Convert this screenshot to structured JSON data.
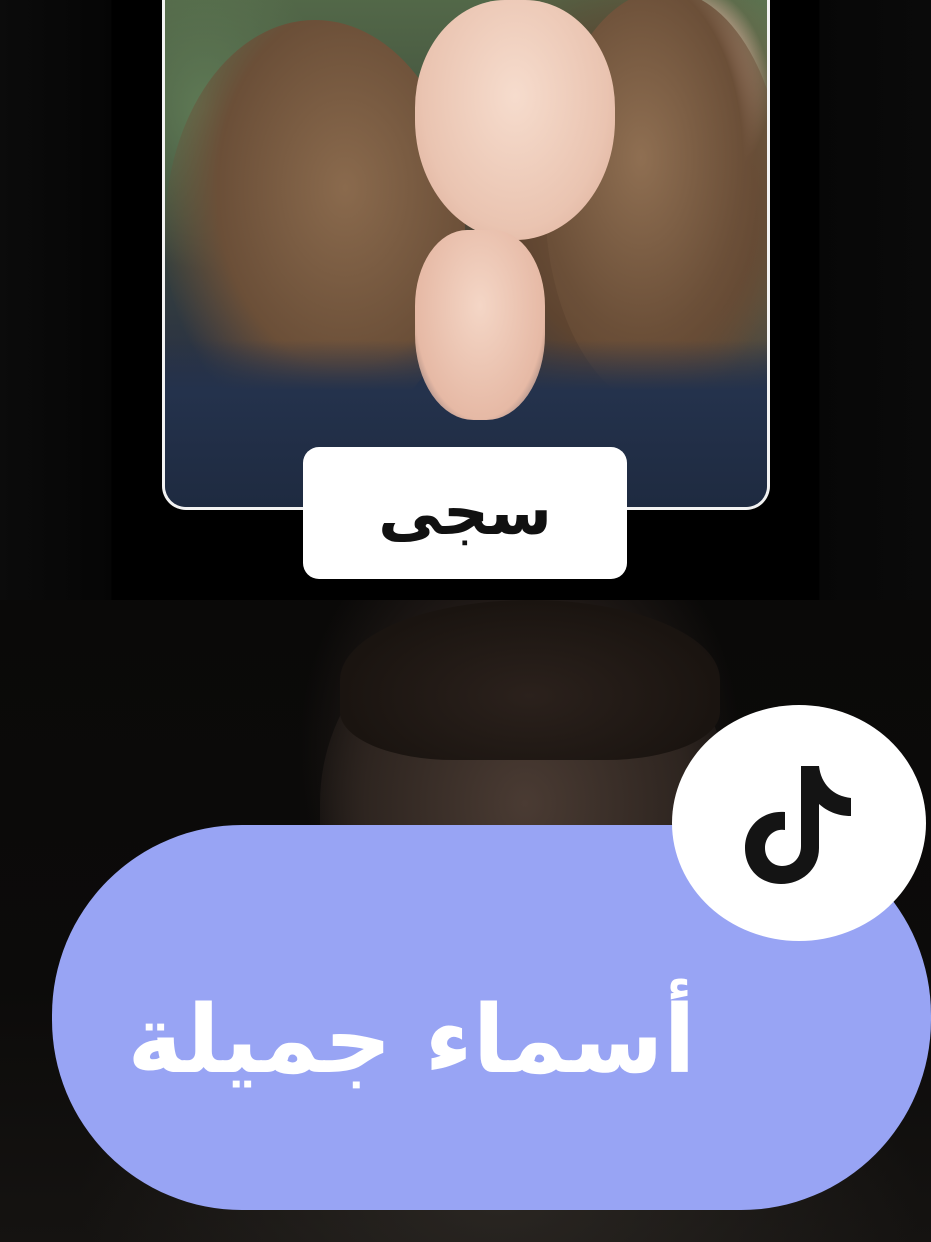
{
  "card": {
    "name_label": "سجى"
  },
  "banner": {
    "title": "أسماء جميلة",
    "accent_color": "#98a4f4",
    "text_color": "#ffffff"
  },
  "badge": {
    "icon": "tiktok-logo-icon"
  }
}
